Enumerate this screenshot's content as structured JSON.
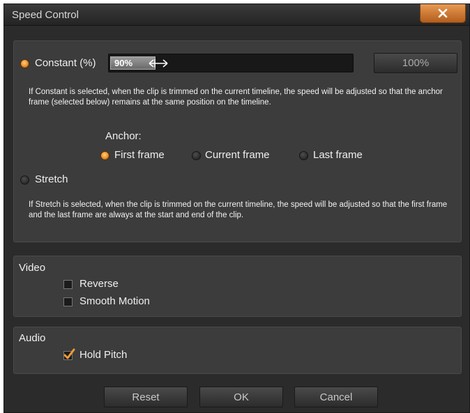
{
  "window": {
    "title": "Speed Control"
  },
  "speed": {
    "constant_label": "Constant (%)",
    "constant_value": "90%",
    "constant_fraction": 0.9,
    "reset_percent_button": "100%",
    "constant_description": "If Constant is selected, when the clip is trimmed on the current timeline, the speed will be adjusted so that the anchor frame (selected below) remains at the same position on the timeline.",
    "anchor": {
      "heading": "Anchor:",
      "options": [
        "First frame",
        "Current frame",
        "Last frame"
      ],
      "selected": "First frame"
    },
    "stretch_label": "Stretch",
    "stretch_description": "If Stretch is selected, when the clip is trimmed on the current timeline, the speed will be adjusted so that the first frame and the last frame are always at the start and end of the clip.",
    "mode_selected": "Constant (%)"
  },
  "video": {
    "heading": "Video",
    "reverse_label": "Reverse",
    "reverse_checked": false,
    "smooth_label": "Smooth Motion",
    "smooth_checked": false
  },
  "audio": {
    "heading": "Audio",
    "hold_pitch_label": "Hold Pitch",
    "hold_pitch_checked": true
  },
  "buttons": {
    "reset": "Reset",
    "ok": "OK",
    "cancel": "Cancel"
  },
  "colors": {
    "accent": "#f19a33",
    "close_button": "#d67a34",
    "panel": "#3c3c3c",
    "background": "#2b2b2b"
  }
}
